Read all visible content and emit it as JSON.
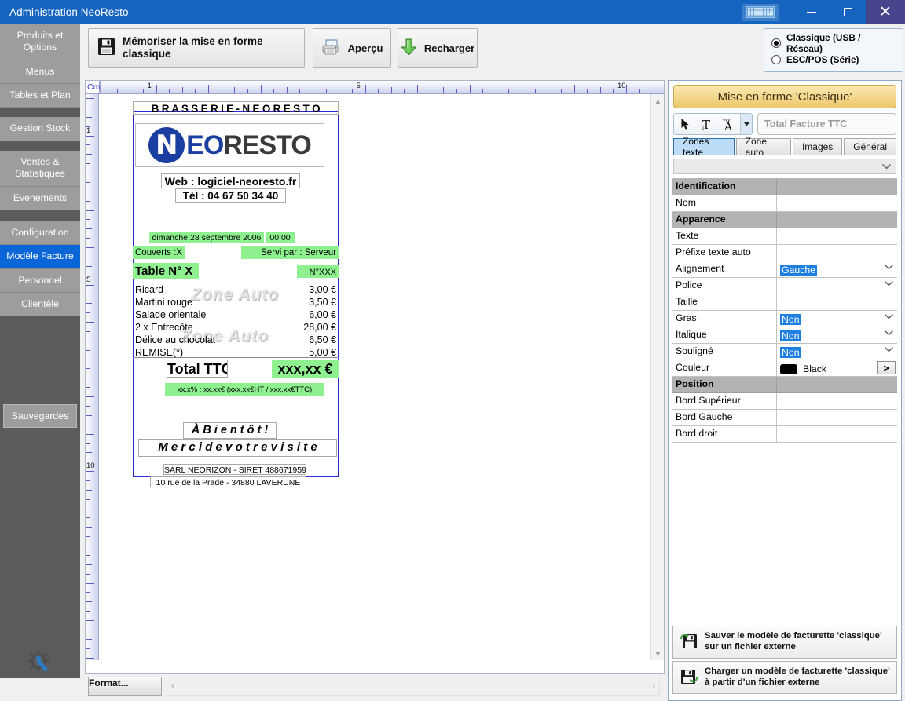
{
  "window": {
    "title": "Administration NeoResto",
    "buttons": {
      "keyboard": "keyboard-icon",
      "minimize": "—",
      "maximize": "□",
      "close": "✕"
    }
  },
  "sidebar": {
    "items": [
      {
        "label": "Produits et Options",
        "active": false
      },
      {
        "label": "Menus",
        "active": false
      },
      {
        "label": "Tables et Plan",
        "active": false
      },
      {
        "label": "Gestion Stock",
        "active": false
      },
      {
        "label": "Ventes & Statistiques",
        "active": false
      },
      {
        "label": "Evenements",
        "active": false
      },
      {
        "label": "Configuration",
        "active": false
      },
      {
        "label": "Modèle Facture",
        "active": true
      },
      {
        "label": "Personnel",
        "active": false
      },
      {
        "label": "Clientèle",
        "active": false
      }
    ],
    "backup_label": "Sauvegardes",
    "gear_icon": "gear-wrench-icon"
  },
  "toolbar": {
    "memoriser_label": "Mémoriser la mise en forme classique",
    "apercu_label": "Aperçu",
    "recharger_label": "Recharger",
    "printer_mode": {
      "options": [
        {
          "label": "Classique (USB / Réseau)",
          "selected": true
        },
        {
          "label": "ESC/POS (Série)",
          "selected": false
        }
      ]
    }
  },
  "ruler": {
    "unit_label": "Cm",
    "h_labels": [
      "1",
      "5",
      "10"
    ],
    "v_labels": [
      "1",
      "5",
      "10"
    ]
  },
  "nav": {
    "left": "arrow-left-icon",
    "right": "arrow-right-icon",
    "up": "arrow-up-icon",
    "down": "arrow-down-icon",
    "delete": "delete-x-icon"
  },
  "bottom": {
    "format_label": "Format...",
    "scroll_left": "‹",
    "scroll_right": "›"
  },
  "receipt": {
    "header": "B R A S S E R I E  -  N E O R E S T O",
    "logo": {
      "badge": "N",
      "part1": "EO",
      "part2": "RESTO"
    },
    "web": "Web : logiciel-neoresto.fr",
    "tel": "Tél : 04 67 50 34 40",
    "date": "dimanche 28 septembre 2006",
    "time": "00:00",
    "couverts": "Couverts :X",
    "servi_par": "Servi par : Serveur",
    "table": "Table N° X",
    "numero": "N°XXX",
    "zone_auto_label": "Zone Auto",
    "lines": [
      {
        "name": "Ricard",
        "price": "3,00 €"
      },
      {
        "name": "Martini rouge",
        "price": "3,50 €"
      },
      {
        "name": "Salade orientale",
        "price": "6,00 €"
      },
      {
        "name": "2 x Entrecôte",
        "price": "28,00 €"
      },
      {
        "name": "Délice au chocolat",
        "price": "6,50 €"
      },
      {
        "name": "REMISE(*)",
        "price": "5,00 €"
      }
    ],
    "total_label": "Total TTC",
    "total_value": "xxx,xx €",
    "tva_line": "xx,x% : xx,xx€ (xxx,xx€HT / xxx,xx€TTC)",
    "bientot": "À  B i e n t ô t !",
    "merci": "M e r c i   d e   v o t r e   v i s i t e",
    "siret": "SARL NEORIZON - SIRET 488671959",
    "address": "10 rue de la Prade - 34880 LAVERUNE"
  },
  "props": {
    "title": "Mise en forme 'Classique'",
    "tools": [
      {
        "name": "select-arrow-icon"
      },
      {
        "name": "text-tool-icon"
      },
      {
        "name": "auto-text-tool-icon"
      },
      {
        "name": "chevron-down-icon"
      }
    ],
    "zone_field_placeholder": "Total Facture TTC",
    "zone_field_value": "",
    "tabs": [
      {
        "label": "Zones texte",
        "active": true
      },
      {
        "label": "Zone auto",
        "active": false
      },
      {
        "label": "Images",
        "active": false
      },
      {
        "label": "Général",
        "active": false
      }
    ],
    "combo_value": "",
    "grid": [
      {
        "type": "section",
        "key": "Identification",
        "value": ""
      },
      {
        "type": "row",
        "key": "Nom",
        "value": ""
      },
      {
        "type": "section",
        "key": "Apparence",
        "value": ""
      },
      {
        "type": "row",
        "key": "Texte",
        "value": ""
      },
      {
        "type": "row",
        "key": "Préfixe texte auto",
        "value": ""
      },
      {
        "type": "row",
        "key": "Alignement",
        "value": "Gauche",
        "selected": true,
        "dropdown": true
      },
      {
        "type": "row",
        "key": "Police",
        "value": "",
        "dropdown": true
      },
      {
        "type": "row",
        "key": "Taille",
        "value": ""
      },
      {
        "type": "row",
        "key": "Gras",
        "value": "Non",
        "selected": true,
        "dropdown": true
      },
      {
        "type": "row",
        "key": "Italique",
        "value": "Non",
        "selected": true,
        "dropdown": true
      },
      {
        "type": "row",
        "key": "Souligné",
        "value": "Non",
        "selected": true,
        "dropdown": true
      },
      {
        "type": "row",
        "key": "Couleur",
        "value": "Black",
        "swatch": "#000000",
        "gobutton": ">"
      },
      {
        "type": "section",
        "key": "Position",
        "value": ""
      },
      {
        "type": "row",
        "key": "Bord Supérieur",
        "value": ""
      },
      {
        "type": "row",
        "key": "Bord Gauche",
        "value": ""
      },
      {
        "type": "row",
        "key": "Bord droit",
        "value": ""
      }
    ],
    "save_file_label": "Sauver le modèle de facturette 'classique' sur un fichier externe",
    "load_file_label": "Charger un modèle de facturette 'classique' à partir d'un fichier externe"
  },
  "colors": {
    "titlebar": "#1565c0",
    "sidebar_bg": "#5b5b5b",
    "sidebar_item": "#9d9d9d",
    "sidebar_active": "#0a66d6",
    "accent_select": "#1f7fe0",
    "receipt_highlight": "#8ef08e",
    "panel_title": "#edc86a"
  }
}
